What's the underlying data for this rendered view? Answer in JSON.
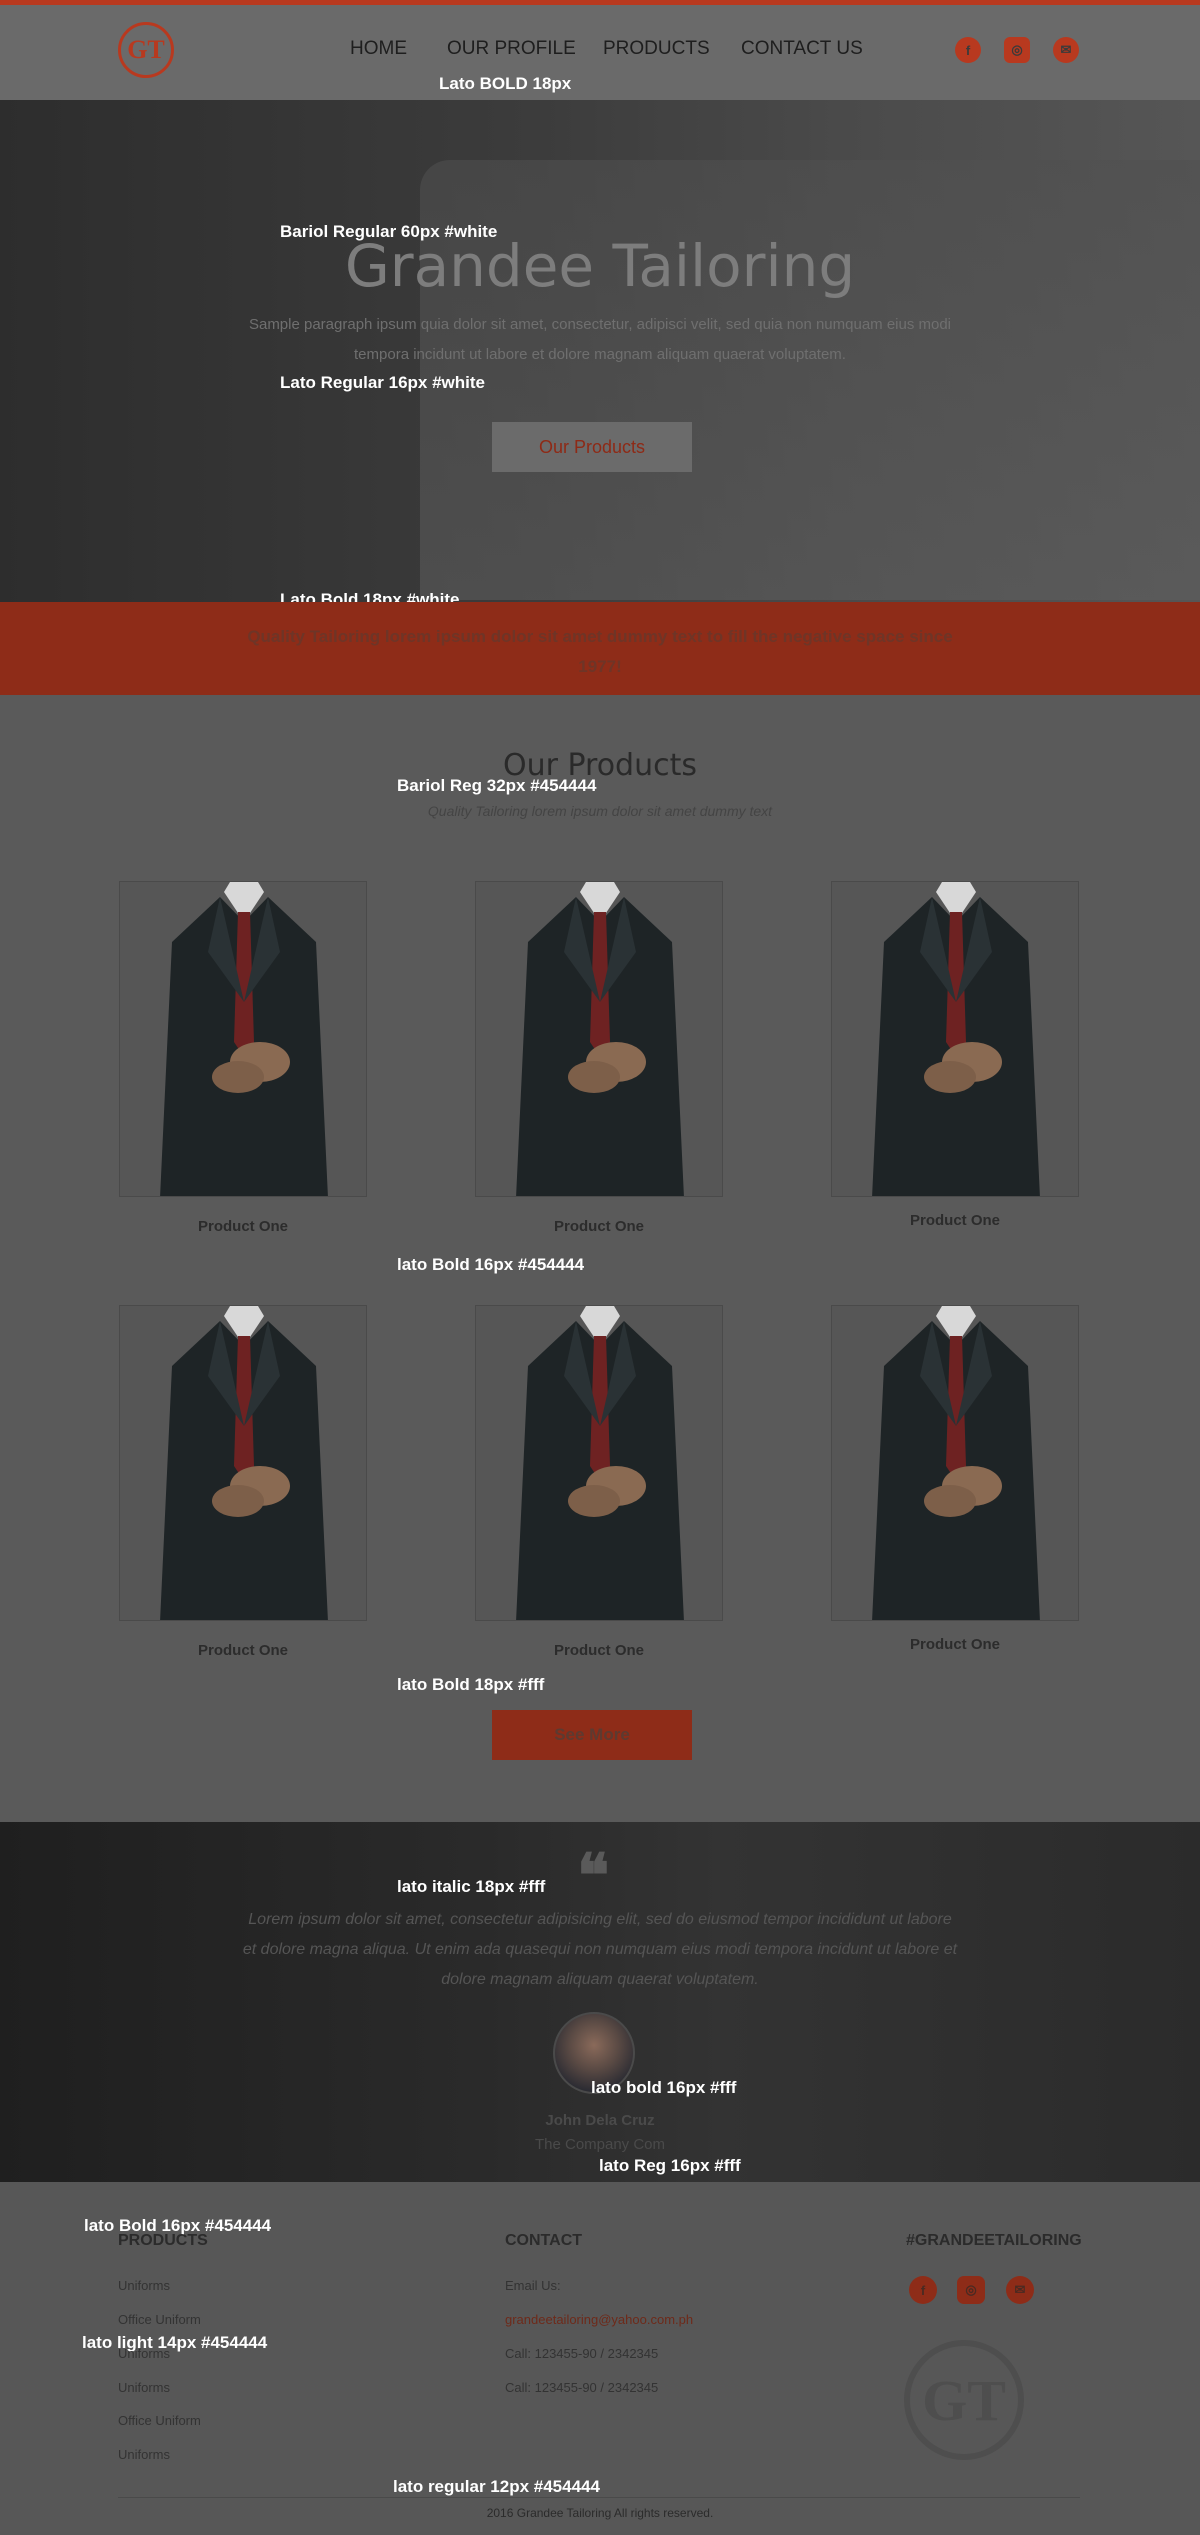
{
  "brand": {
    "logo_text": "GT",
    "accent": "#b8391f"
  },
  "nav": [
    "HOME",
    "OUR PROFILE",
    "PRODUCTS",
    "CONTACT US"
  ],
  "social_icons": [
    "facebook-icon",
    "instagram-icon",
    "mail-icon"
  ],
  "annotations": {
    "nav_font": "Lato  BOLD  18px",
    "hero_title_font": "Bariol  Regular  60px #white",
    "hero_para_font": "Lato   Regular  16px #white",
    "band_font": "Lato   Bold  18px #white",
    "sec_title_font": "Bariol   Reg  32px #454444",
    "product_name_font": "lato   Bold  16px #454444",
    "see_more_font": "lato   Bold  18px #fff",
    "testi_font": "lato   italic  18px #fff",
    "person_font": "lato   bold 16px #fff",
    "company_font": "lato   Reg 16px #fff",
    "footer_head_font": "lato   Bold 16px #454444",
    "footer_link_font": "lato   light 14px #454444",
    "copyright_font": "lato   regular 12px #454444"
  },
  "hero": {
    "title": "Grandee Tailoring",
    "paragraph": "Sample paragraph ipsum quia dolor sit amet, consectetur, adipisci velit, sed quia non numquam eius modi tempora incidunt ut labore et dolore magnam aliquam quaerat voluptatem.",
    "button": "Our Products"
  },
  "band": {
    "text": "Quality Tailoring lorem ipsum dolor sit amet dummy text to fill the negative space since 1977!"
  },
  "products": {
    "title": "Our Products",
    "subtitle": "Quality Tailoring lorem ipsum dolor sit amet dummy text",
    "items": [
      "Product One",
      "Product One",
      "Product One",
      "Product One",
      "Product One",
      "Product One"
    ],
    "see_more": "See More"
  },
  "testimonial": {
    "quote_mark": "❝",
    "text": "Lorem ipsum dolor sit amet, consectetur adipisicing elit, sed do eiusmod tempor incididunt ut labore et dolore magna aliqua. Ut enim ada quasequi non numquam eius modi tempora incidunt ut labore et dolore magnam aliquam quaerat voluptatem.",
    "name": "John Dela Cruz",
    "company": "The Company Com"
  },
  "footer": {
    "products_head": "PRODUCTS",
    "products_links": [
      "Uniforms",
      "Office Uniform",
      "Uniforms",
      "Uniforms",
      "Office Uniform",
      "Uniforms"
    ],
    "contact_head": "CONTACT",
    "email_label": "Email Us:",
    "email": "grandeetailoring@yahoo.com.ph",
    "call1": "Call:  123455-90 / 2342345",
    "call2": "Call:  123455-90 / 2342345",
    "hashtag_head": "#GRANDEETAILORING",
    "copyright": "2016  Grandee Tailoring   All rights reserved."
  }
}
